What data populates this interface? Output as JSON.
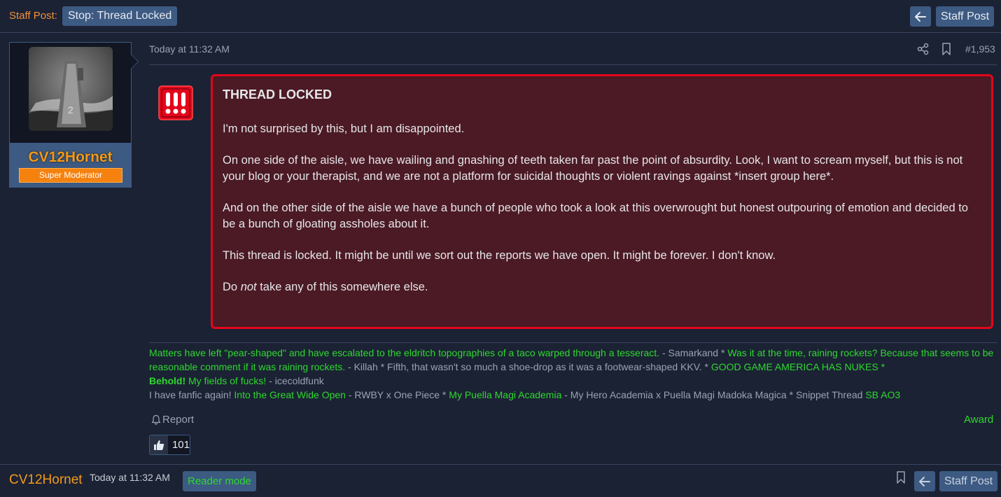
{
  "topbar": {
    "staff_label": "Staff Post:",
    "tag": "Stop: Thread Locked",
    "staff_post_button": "Staff Post",
    "back_icon": "arrow-left-icon"
  },
  "user": {
    "name": "CV12Hornet",
    "role": "Super Moderator",
    "avatar": "aircraft-carrier-photo"
  },
  "post": {
    "time": "Today at 11:32 AM",
    "number": "#1,953",
    "share_icon": "share-icon",
    "bookmark_icon": "bookmark-icon",
    "alert_icon": "triple-exclamation-alert-icon",
    "title": "THREAD LOCKED",
    "p1": "I'm not surprised by this, but I am disappointed.",
    "p2": "On one side of the aisle, we have wailing and gnashing of teeth taken far past the point of absurdity. Look, I want to scream myself, but this is not your blog or your therapist, and we are not a platform for suicidal thoughts or violent ravings against *insert group here*.",
    "p3": "And on the other side of the aisle we have a bunch of people who took a look at this overwrought but honest outpouring of emotion and decided to be a bunch of gloating assholes about it.",
    "p4": "This thread is locked. It might be until we sort out the reports we have open. It might be forever. I don't know.",
    "p5_a": "Do ",
    "p5_em": "not",
    "p5_b": " take any of this somewhere else."
  },
  "signature": {
    "q1": "Matters have left \"pear-shaped\" and have escalated to the eldritch topographies of a taco warped through a tesseract.",
    "a1": " - Samarkand * ",
    "q2": "Was it at the time, raining rockets? Because that seems to be reasonable comment if it was raining rockets.",
    "a2": " - Killah * Fifth, that wasn't so much a shoe-drop as it was a footwear-shaped KKV. * ",
    "q3": "GOOD GAME AMERICA HAS NUKES *",
    "q4b": "Behold!",
    "q4": " My fields of fucks!",
    "a4": " - icecoldfunk",
    "line3_a": "I have fanfic again! ",
    "link1": "Into the Great Wide Open",
    "line3_b": " - RWBY x One Piece * ",
    "link2": "My Puella Magi Academia",
    "line3_c": " - My Hero Academia x Puella Magi Madoka Magica * Snippet Thread ",
    "link3": "SB",
    "link4": "AO3"
  },
  "actions": {
    "report": "Report",
    "report_icon": "bell-icon",
    "award": "Award",
    "reaction_icon": "thumbs-up-icon",
    "reaction_count": "101"
  },
  "bottombar": {
    "user": "CV12Hornet",
    "time": "Today at 11:32 AM",
    "reader_mode": "Reader mode",
    "staff_post_button": "Staff Post"
  },
  "colors": {
    "background": "#1b2234",
    "accent": "#3d5a82",
    "username": "#f39a1a",
    "alert_border": "#e3061b",
    "alert_bg": "#4b1a24",
    "signature_green": "#2ed82e"
  }
}
